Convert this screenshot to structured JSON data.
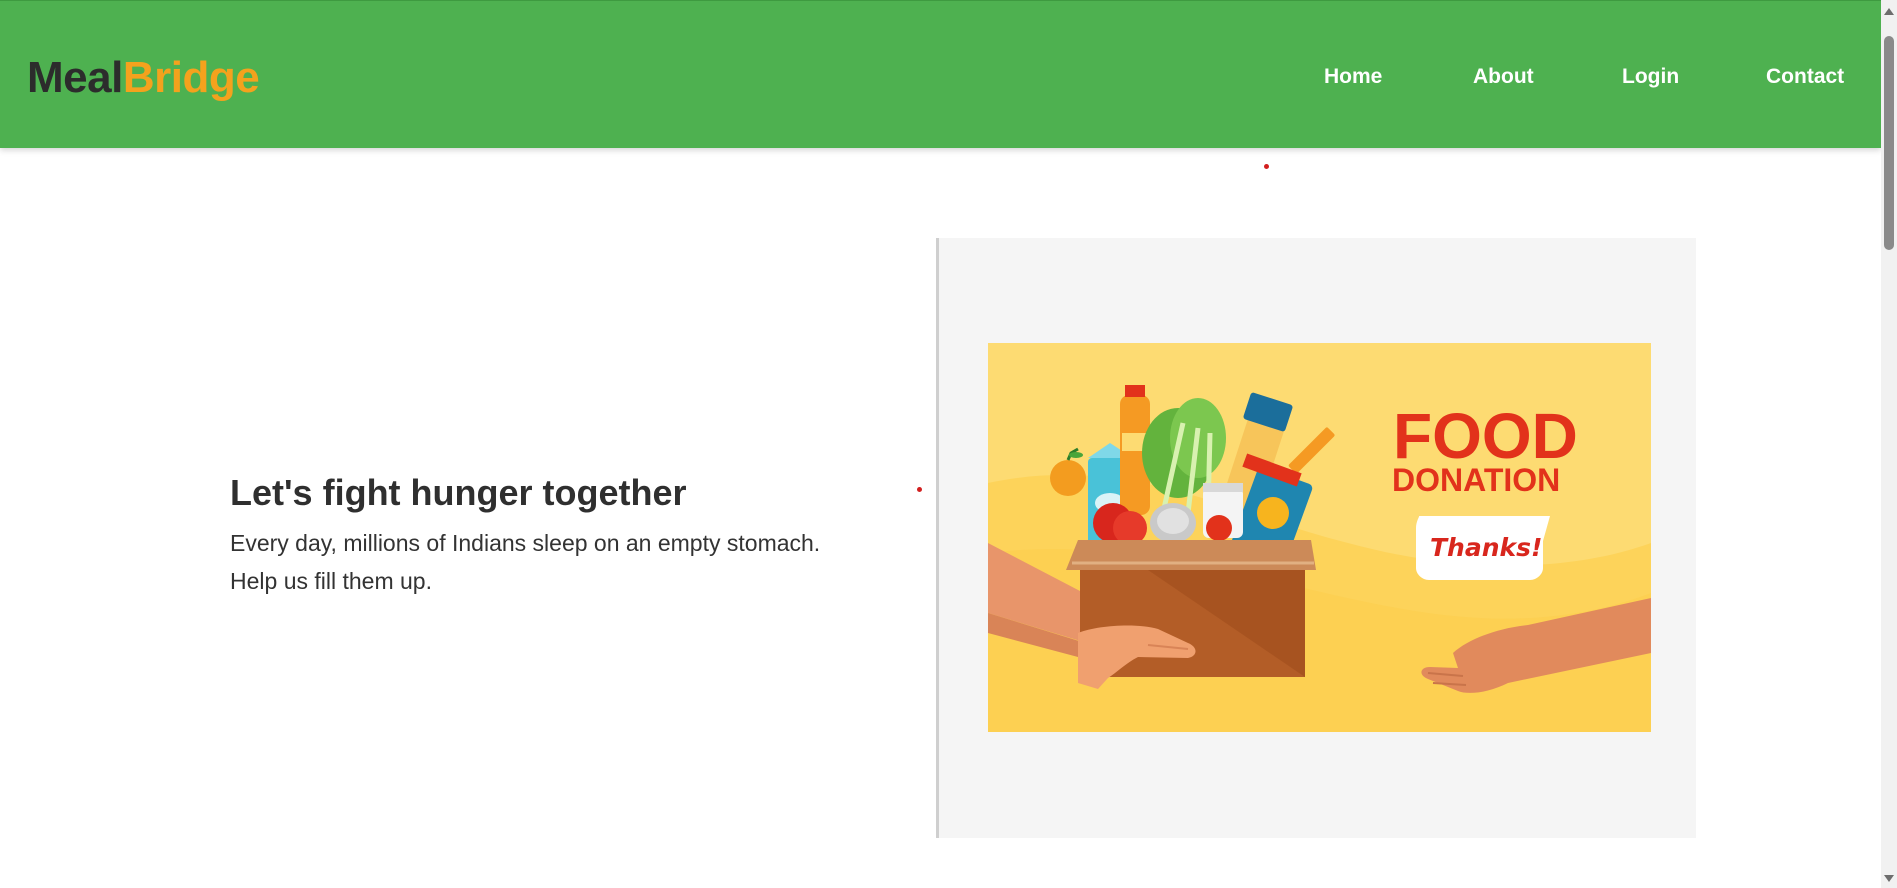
{
  "brand": {
    "part1": "Meal",
    "part2": "Bridge",
    "color_part1": "#2c2c2c",
    "color_part2": "#f4a21d"
  },
  "nav": {
    "bg_color": "#4eb150",
    "links": [
      {
        "label": "Home"
      },
      {
        "label": "About"
      },
      {
        "label": "Login"
      },
      {
        "label": "Contact"
      }
    ]
  },
  "hero": {
    "title": "Let's fight hunger together",
    "description": "Every day, millions of Indians sleep on an empty stomach. Help us fill them up."
  },
  "illustration": {
    "headline_1": "FOOD",
    "headline_2": "DONATION",
    "bubble_text": "Thanks!",
    "bg_color": "#fddb72",
    "accent_color": "#e2321b"
  }
}
